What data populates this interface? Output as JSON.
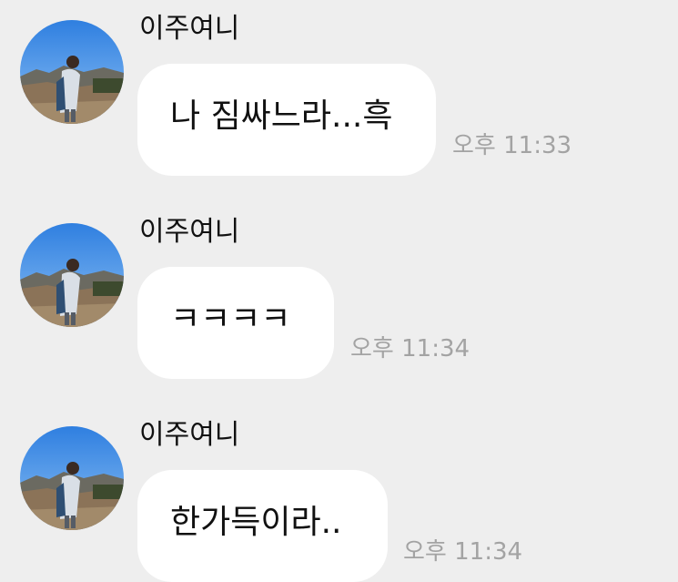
{
  "messages": [
    {
      "sender": "이주여니",
      "text": "나 짐싸느라...흑",
      "time": "오후 11:33"
    },
    {
      "sender": "이주여니",
      "text": "ㅋㅋㅋㅋ",
      "time": "오후 11:34"
    },
    {
      "sender": "이주여니",
      "text": "한가득이라..",
      "time": "오후 11:34"
    }
  ],
  "colors": {
    "background": "#eeeeee",
    "bubble": "#ffffff",
    "time_text": "#a3a3a3",
    "name_text": "#111111"
  },
  "icons": {
    "avatar": "profile-photo-person-in-field"
  }
}
